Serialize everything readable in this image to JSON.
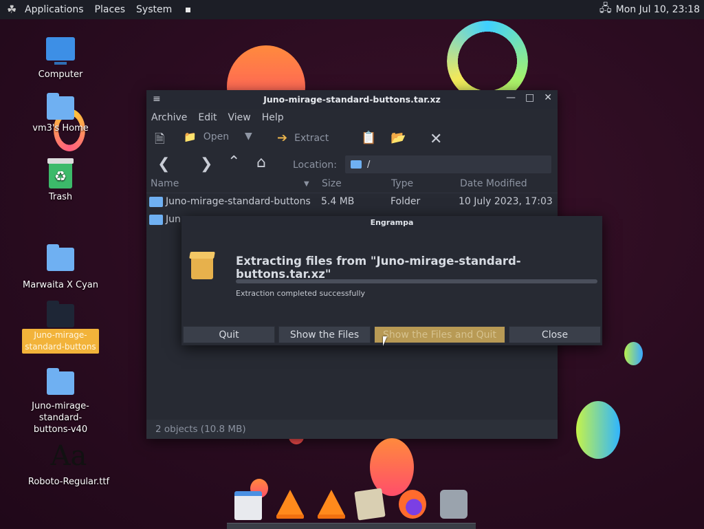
{
  "panel": {
    "menus": [
      "Applications",
      "Places",
      "System"
    ],
    "clock": "Mon Jul 10, 23:18",
    "icons": [
      "gnome-foot-icon",
      "network-icon"
    ]
  },
  "desktop": {
    "icons": [
      {
        "label": "Computer",
        "icon": "computer-icon"
      },
      {
        "label": "vm3's Home",
        "icon": "home-folder-icon"
      },
      {
        "label": "Trash",
        "icon": "trash-icon"
      },
      {
        "label": "Marwaita X Cyan",
        "icon": "folder-icon"
      },
      {
        "label": "Juno-mirage-standard-buttons",
        "icon": "folder-icon",
        "selected": true
      },
      {
        "label": "Juno-mirage-standard-buttons-v40",
        "icon": "folder-icon"
      },
      {
        "label": "Roboto-Regular.ttf",
        "icon": "font-file-icon",
        "glyph": "Aa"
      }
    ]
  },
  "window": {
    "title": "Juno-mirage-standard-buttons.tar.xz",
    "menubar": [
      "Archive",
      "Edit",
      "View",
      "Help"
    ],
    "toolbar": {
      "open_label": "Open",
      "extract_label": "Extract"
    },
    "location_label": "Location:",
    "location_value": "/",
    "columns": [
      "Name",
      "Size",
      "Type",
      "Date Modified"
    ],
    "rows": [
      {
        "name": "Juno-mirage-standard-buttons",
        "size": "5.4 MB",
        "type": "Folder",
        "modified": "10 July 2023, 17:03"
      },
      {
        "name": "Juno-mirage-standard-buttons-v40",
        "size": "",
        "type": "",
        "modified": ""
      }
    ],
    "row2_visible": "Jun",
    "status": "2 objects (10.8 MB)"
  },
  "dialog": {
    "title": "Engrampa",
    "heading": "Extracting files from \"Juno-mirage-standard-buttons.tar.xz\"",
    "progress": 1.0,
    "status": "Extraction completed successfully",
    "buttons": [
      "Quit",
      "Show the Files",
      "Show the Files and Quit",
      "Close"
    ]
  },
  "dock": {
    "items": [
      "window-list-icon",
      "vlc-icon",
      "vlc-icon",
      "image-viewer-icon",
      "firefox-icon",
      "printer-icon"
    ]
  },
  "colors": {
    "accent": "#f2b33a",
    "folder": "#6fb0f2",
    "panel": "#1c1e26",
    "window": "#272a33"
  }
}
